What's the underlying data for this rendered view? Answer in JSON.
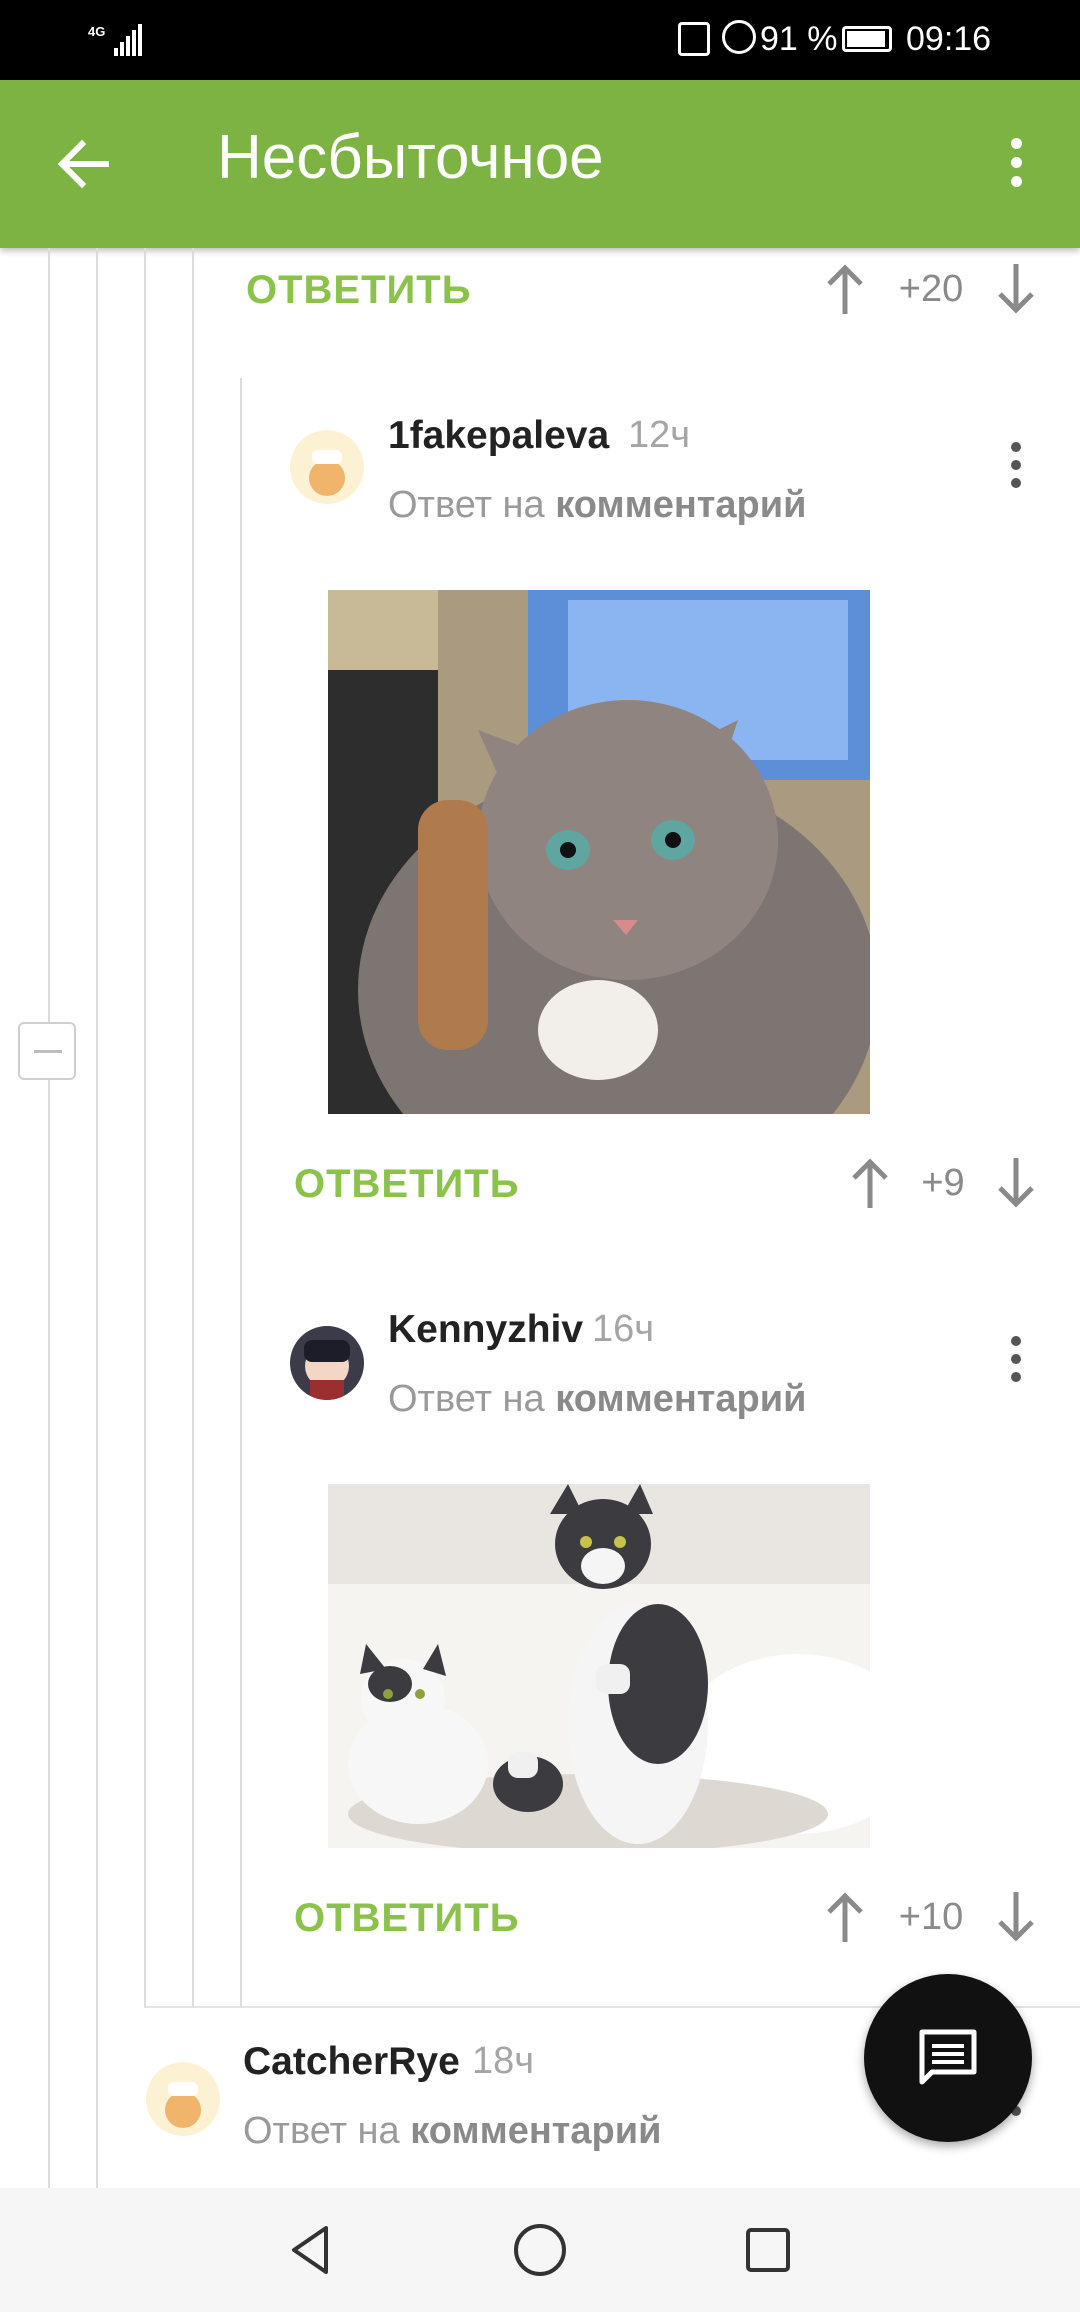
{
  "status_bar": {
    "network": "4G",
    "battery_percent": "91 %",
    "time": "09:16"
  },
  "app_bar": {
    "title": "Несбыточное",
    "back_icon": "arrow-left-icon",
    "menu_icon": "more-vert-icon"
  },
  "comments": [
    {
      "id": "top",
      "reply_label": "ОТВЕТИТЬ",
      "score": "+20"
    },
    {
      "id": "c1",
      "username": "1fakepaleva",
      "time": "12ч",
      "reply_prefix": "Ответ на",
      "reply_target": "комментарий",
      "image_alt": "cat-photo",
      "reply_label": "ОТВЕТИТЬ",
      "score": "+9"
    },
    {
      "id": "c2",
      "username": "Kennyzhiv",
      "time": "16ч",
      "reply_prefix": "Ответ на",
      "reply_target": "комментарий",
      "image_alt": "two-cats-photo",
      "reply_label": "ОТВЕТИТЬ",
      "score": "+10"
    },
    {
      "id": "c3",
      "username": "CatcherRye",
      "time": "18ч",
      "reply_prefix": "Ответ на",
      "reply_target": "комментарий"
    }
  ],
  "colors": {
    "accent": "#7cb342",
    "reply": "#8bc34a",
    "fab": "#111111"
  },
  "fab_icon": "comment-icon",
  "nav": {
    "back_icon": "triangle-back-icon",
    "home_icon": "circle-home-icon",
    "recents_icon": "square-recents-icon"
  }
}
